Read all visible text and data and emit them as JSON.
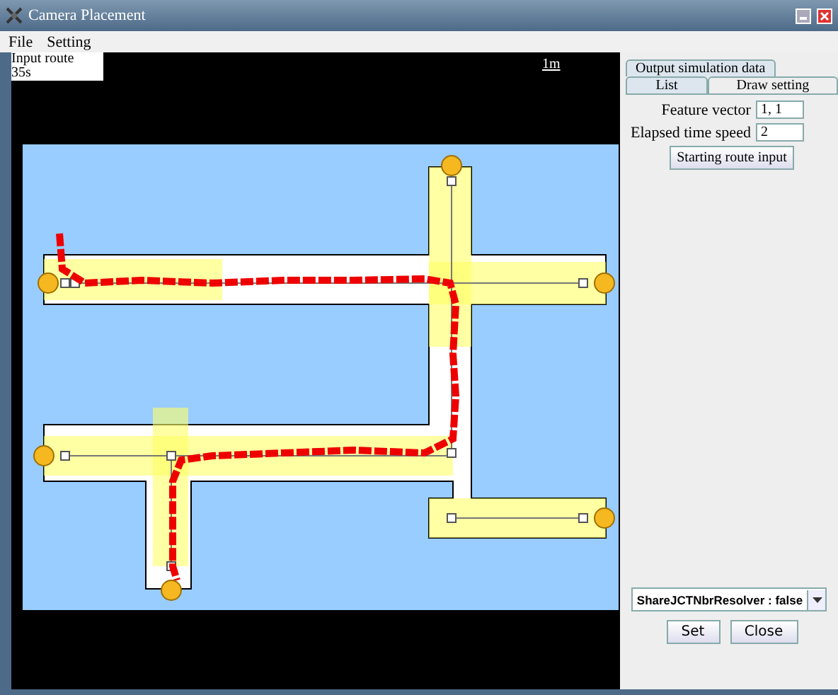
{
  "window": {
    "title": "Camera Placement"
  },
  "menu": [
    "File",
    "Setting"
  ],
  "canvas": {
    "overlay_lines": [
      "Input route",
      "35s"
    ],
    "scale_label": "1m"
  },
  "tabs": [
    [
      {
        "label": "Output simulation data",
        "selected": false
      }
    ],
    [
      {
        "label": "List",
        "selected": false
      },
      {
        "label": "Draw setting",
        "selected": true
      }
    ]
  ],
  "fields": [
    {
      "label": "Feature vector",
      "value": "1, 1"
    },
    {
      "label": "Elapsed time speed",
      "value": "2"
    }
  ],
  "start_button": "Starting route input",
  "dropdown": {
    "value": "ShareJCTNbrResolver : false"
  },
  "buttons": [
    "Set",
    "Close"
  ]
}
